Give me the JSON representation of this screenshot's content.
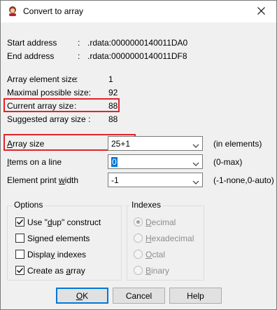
{
  "window": {
    "title": "Convert to array",
    "icon": "ida-app-icon",
    "close_icon": "close-icon"
  },
  "info": {
    "start_address_label": "Start address",
    "start_address_sep": ":",
    "start_address_value": ".rdata:0000000140011DA0",
    "end_address_label": "End address",
    "end_address_sep": ":",
    "end_address_value": ".rdata:0000000140011DF8",
    "element_size_label": "Array element size",
    "element_size_sep": ":",
    "element_size_value": "1",
    "max_size_label": "Maximal possible size:",
    "max_size_value": "92",
    "current_size_label": "Current array size",
    "current_size_sep": ":",
    "current_size_value": "88",
    "suggested_size_label": "Suggested array size :",
    "suggested_size_value": "88"
  },
  "fields": {
    "array_size": {
      "label_first": "A",
      "label_rest": "rray size",
      "value": "25+1",
      "hint": "(in elements)"
    },
    "items_on_line": {
      "label_first": "I",
      "label_rest": "tems on a line",
      "value": "0",
      "hint": "(0-max)"
    },
    "print_width": {
      "label_pre": "Element print ",
      "label_u": "w",
      "label_post": "idth",
      "value": "-1",
      "hint": "(-1-none,0-auto)"
    }
  },
  "options": {
    "legend": "Options",
    "items": [
      {
        "pre": "Use \"",
        "u": "d",
        "post": "up\" construct",
        "checked": true
      },
      {
        "pre": "Si",
        "u": "g",
        "post": "ned elements",
        "checked": false
      },
      {
        "pre": "Displa",
        "u": "y",
        "post": " indexes",
        "checked": false
      },
      {
        "pre": "Create as ",
        "u": "a",
        "post": "rray",
        "checked": true
      }
    ]
  },
  "indexes": {
    "legend": "Indexes",
    "items": [
      {
        "u": "D",
        "post": "ecimal",
        "selected": true
      },
      {
        "u": "H",
        "post": "exadecimal",
        "selected": false
      },
      {
        "u": "O",
        "post": "ctal",
        "selected": false
      },
      {
        "u": "B",
        "post": "inary",
        "selected": false
      }
    ]
  },
  "buttons": {
    "ok_u": "O",
    "ok_rest": "K",
    "cancel": "Cancel",
    "help": "Help"
  },
  "colors": {
    "highlight": "#e0242a",
    "selection": "#0078d7",
    "default_button": "#0078d7"
  }
}
